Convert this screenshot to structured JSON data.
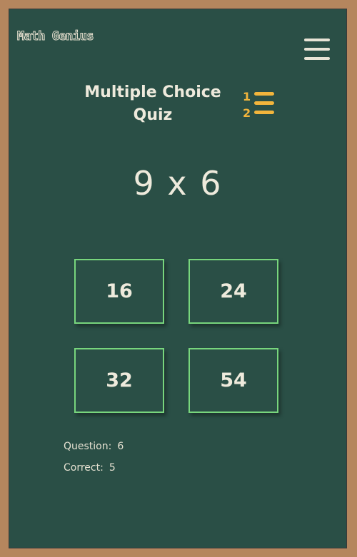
{
  "app": {
    "logo": "Math Genius"
  },
  "header": {
    "title_line1": "Multiple Choice",
    "title_line2": "Quiz",
    "list_icon_numbers": [
      "1",
      "2"
    ]
  },
  "quiz": {
    "problem": "9 x 6",
    "answers": [
      "16",
      "24",
      "32",
      "54"
    ]
  },
  "stats": {
    "question_label": "Question:",
    "question_value": "6",
    "correct_label": "Correct:",
    "correct_value": "5"
  },
  "colors": {
    "board": "#2a4f46",
    "frame": "#b5865e",
    "chalk": "#eeeadc",
    "answer_border": "#78d67d",
    "icon_accent": "#f2b53c"
  },
  "icons": {
    "menu": "hamburger-menu-icon",
    "list": "numbered-list-icon"
  }
}
